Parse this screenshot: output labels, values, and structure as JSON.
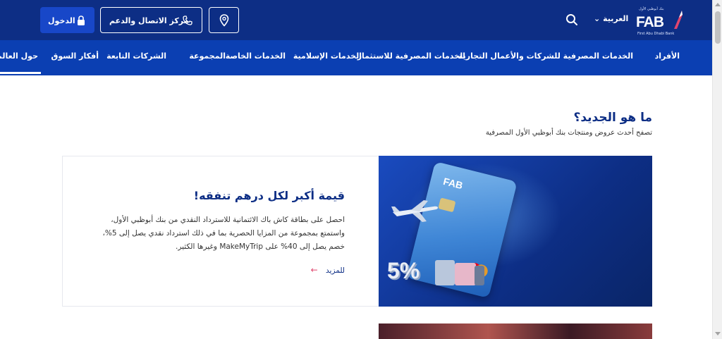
{
  "header": {
    "logo_text": "FAB",
    "logo_small_top": "بنك أبوظبي الأول",
    "logo_small_bottom": "First Abu Dhabi Bank",
    "language": "العربية",
    "search_icon": "search-icon",
    "location_icon": "map-pin-icon",
    "contact_label": "مركز الاتصال والدعم",
    "contact_icon": "phone-icon",
    "login_label": "الدخول",
    "login_icon": "lock-icon"
  },
  "nav": {
    "items": [
      "الأفراد",
      "الخدمات المصرفية للشركات والأعمال التجارية",
      "الخدمات المصرفية للاستثمار",
      "الخدمات الإسلامية",
      "الخدمات الخاصة",
      "المجموعة",
      "الشركات التابعة",
      "أفكار السوق",
      "حول العالم"
    ]
  },
  "section": {
    "title": "ما هو الجديد؟",
    "subtitle": "تصفح أحدث عروض ومنتجات بنك أبوظبي الأول المصرفية"
  },
  "card": {
    "title": "قيمة أكبر لكل درهم تنفقه!",
    "body_lines": [
      "احصل على بطاقة كاش باك الائتمانية للاسترداد النقدي من بنك أبوظبي الأول،",
      "واستمتع بمجموعة من المزايا الحصرية بما في ذلك استرداد نقدي يصل إلى 5%،",
      "خصم يصل إلى 40% على MakeMyTrip وغيرها الكثير."
    ],
    "more_label": "للمزيد",
    "image_badge": "5%",
    "card_brand": "FAB",
    "colors": {
      "brand_dark": "#0d2e85",
      "brand_nav": "#0b3fb2",
      "accent_arrow": "#e0456e"
    }
  }
}
